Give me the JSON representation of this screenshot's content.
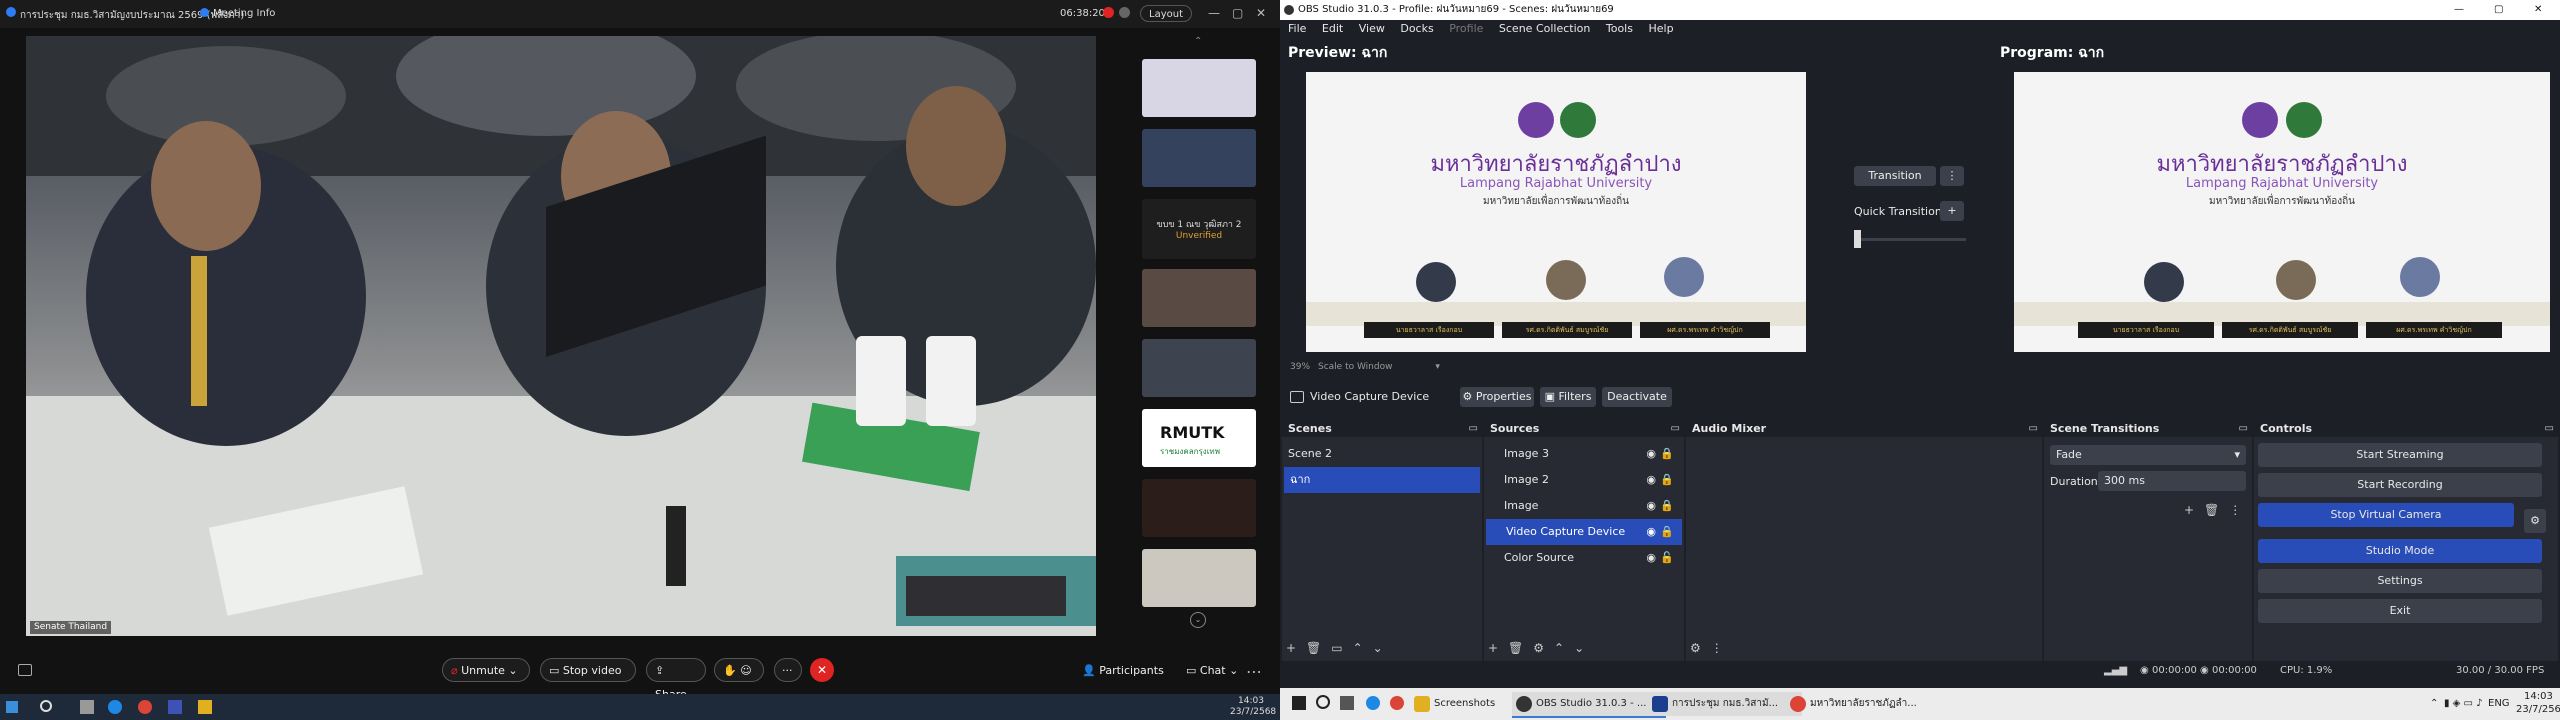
{
  "webex": {
    "title": "การประชุม กมธ.วิสามัญงบประมาณ 2569 (พลังภา)",
    "meeting_info": "Meeting Info",
    "timer": "06:38:20",
    "layout_label": "Layout",
    "name_tag": "Senate Thailand",
    "strip": {
      "participant_name": "ขบข 1 ณข วุฒิสภา 2",
      "unverified": "Unverified",
      "rmutk_text": "RMUTK",
      "rmutk_sub": "ราชมงคลกรุงเทพ"
    },
    "controls": {
      "unmute": "Unmute",
      "stop_video": "Stop video",
      "share": "Share",
      "participants": "Participants",
      "chat": "Chat"
    },
    "tray": {
      "time": "14:03",
      "date": "23/7/2568"
    }
  },
  "obs": {
    "title": "OBS Studio 31.0.3 - Profile: ฝนวันหมาย69 - Scenes: ฝนวันหมาย69",
    "menu": [
      "File",
      "Edit",
      "View",
      "Docks",
      "Profile",
      "Scene Collection",
      "Tools",
      "Help"
    ],
    "preview_label": "Preview: ฉาก",
    "program_label": "Program: ฉาก",
    "zoom": "39%",
    "scale_label": "Scale to Window",
    "transition_label": "Transition",
    "quick_transitions": "Quick Transitions",
    "slide": {
      "univ_thai": "มหาวิทยาลัยราชภัฏลำปาง",
      "univ_en": "Lampang Rajabhat University",
      "tagline": "มหาวิทยาลัยเพื่อการพัฒนาท้องถิ่น",
      "names": [
        "นายธวาลาส เรืองกอบ",
        "รศ.ดร.กิตติพันธ์ สมบูรณ์ชัย",
        "ผศ.ดร.พรเทพ คำวิชญ์ปก"
      ]
    },
    "source_toolbar": {
      "source_name": "Video Capture Device",
      "properties": "Properties",
      "filters": "Filters",
      "deactivate": "Deactivate"
    },
    "scenes": {
      "title": "Scenes",
      "items": [
        "Scene 2",
        "ฉาก"
      ],
      "selected": 1
    },
    "sources": {
      "title": "Sources",
      "items": [
        "Image 3",
        "Image 2",
        "Image",
        "Video Capture Device",
        "Color Source"
      ],
      "selected": 3
    },
    "audio_mixer": {
      "title": "Audio Mixer"
    },
    "scene_transitions": {
      "title": "Scene Transitions",
      "type": "Fade",
      "duration_label": "Duration",
      "duration_value": "300 ms"
    },
    "controls": {
      "title": "Controls",
      "start_streaming": "Start Streaming",
      "start_recording": "Start Recording",
      "stop_virtual_camera": "Stop Virtual Camera",
      "studio_mode": "Studio Mode",
      "settings": "Settings",
      "exit": "Exit"
    },
    "status": {
      "stream_time": "00:00:00",
      "record_time": "00:00:00",
      "cpu": "CPU: 1.9%",
      "fps": "30.00 / 30.00 FPS"
    }
  },
  "taskbar": {
    "items": [
      "Screenshots",
      "OBS Studio 31.0.3 - ...",
      "การประชุม กมธ.วิสามั...",
      "มหาวิทยาลัยราชภัฏลำ..."
    ],
    "lang": "ENG",
    "time": "14:03",
    "date": "23/7/2568"
  },
  "colors": {
    "obs_bg": "#1d1f26",
    "obs_panel": "#272a33",
    "obs_accent": "#284cb8",
    "webex_red": "#e02424"
  }
}
